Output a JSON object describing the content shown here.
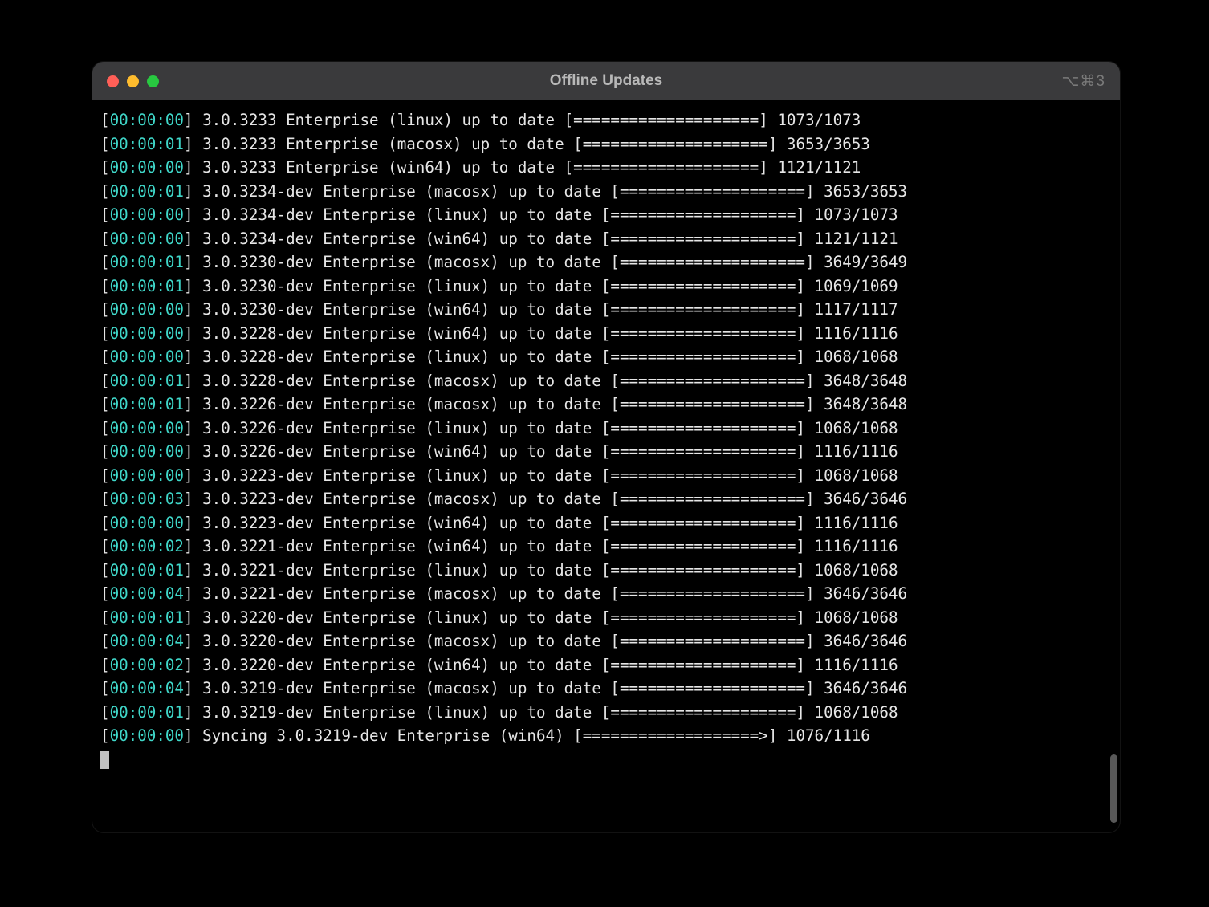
{
  "window": {
    "title": "Offline Updates",
    "shortcut": "⌥⌘3"
  },
  "progress_bars": {
    "full_20": "[====================]",
    "partial_19": "[===================>]"
  },
  "log_lines": [
    {
      "timestamp": "00:00:00",
      "version": "3.0.3233",
      "edition": "Enterprise",
      "platform": "linux",
      "status": "up to date",
      "bar_key": "full_20",
      "done": 1073,
      "total": 1073
    },
    {
      "timestamp": "00:00:01",
      "version": "3.0.3233",
      "edition": "Enterprise",
      "platform": "macosx",
      "status": "up to date",
      "bar_key": "full_20",
      "done": 3653,
      "total": 3653
    },
    {
      "timestamp": "00:00:00",
      "version": "3.0.3233",
      "edition": "Enterprise",
      "platform": "win64",
      "status": "up to date",
      "bar_key": "full_20",
      "done": 1121,
      "total": 1121
    },
    {
      "timestamp": "00:00:01",
      "version": "3.0.3234-dev",
      "edition": "Enterprise",
      "platform": "macosx",
      "status": "up to date",
      "bar_key": "full_20",
      "done": 3653,
      "total": 3653
    },
    {
      "timestamp": "00:00:00",
      "version": "3.0.3234-dev",
      "edition": "Enterprise",
      "platform": "linux",
      "status": "up to date",
      "bar_key": "full_20",
      "done": 1073,
      "total": 1073
    },
    {
      "timestamp": "00:00:00",
      "version": "3.0.3234-dev",
      "edition": "Enterprise",
      "platform": "win64",
      "status": "up to date",
      "bar_key": "full_20",
      "done": 1121,
      "total": 1121
    },
    {
      "timestamp": "00:00:01",
      "version": "3.0.3230-dev",
      "edition": "Enterprise",
      "platform": "macosx",
      "status": "up to date",
      "bar_key": "full_20",
      "done": 3649,
      "total": 3649
    },
    {
      "timestamp": "00:00:01",
      "version": "3.0.3230-dev",
      "edition": "Enterprise",
      "platform": "linux",
      "status": "up to date",
      "bar_key": "full_20",
      "done": 1069,
      "total": 1069
    },
    {
      "timestamp": "00:00:00",
      "version": "3.0.3230-dev",
      "edition": "Enterprise",
      "platform": "win64",
      "status": "up to date",
      "bar_key": "full_20",
      "done": 1117,
      "total": 1117
    },
    {
      "timestamp": "00:00:00",
      "version": "3.0.3228-dev",
      "edition": "Enterprise",
      "platform": "win64",
      "status": "up to date",
      "bar_key": "full_20",
      "done": 1116,
      "total": 1116
    },
    {
      "timestamp": "00:00:00",
      "version": "3.0.3228-dev",
      "edition": "Enterprise",
      "platform": "linux",
      "status": "up to date",
      "bar_key": "full_20",
      "done": 1068,
      "total": 1068
    },
    {
      "timestamp": "00:00:01",
      "version": "3.0.3228-dev",
      "edition": "Enterprise",
      "platform": "macosx",
      "status": "up to date",
      "bar_key": "full_20",
      "done": 3648,
      "total": 3648
    },
    {
      "timestamp": "00:00:01",
      "version": "3.0.3226-dev",
      "edition": "Enterprise",
      "platform": "macosx",
      "status": "up to date",
      "bar_key": "full_20",
      "done": 3648,
      "total": 3648
    },
    {
      "timestamp": "00:00:00",
      "version": "3.0.3226-dev",
      "edition": "Enterprise",
      "platform": "linux",
      "status": "up to date",
      "bar_key": "full_20",
      "done": 1068,
      "total": 1068
    },
    {
      "timestamp": "00:00:00",
      "version": "3.0.3226-dev",
      "edition": "Enterprise",
      "platform": "win64",
      "status": "up to date",
      "bar_key": "full_20",
      "done": 1116,
      "total": 1116
    },
    {
      "timestamp": "00:00:00",
      "version": "3.0.3223-dev",
      "edition": "Enterprise",
      "platform": "linux",
      "status": "up to date",
      "bar_key": "full_20",
      "done": 1068,
      "total": 1068
    },
    {
      "timestamp": "00:00:03",
      "version": "3.0.3223-dev",
      "edition": "Enterprise",
      "platform": "macosx",
      "status": "up to date",
      "bar_key": "full_20",
      "done": 3646,
      "total": 3646
    },
    {
      "timestamp": "00:00:00",
      "version": "3.0.3223-dev",
      "edition": "Enterprise",
      "platform": "win64",
      "status": "up to date",
      "bar_key": "full_20",
      "done": 1116,
      "total": 1116
    },
    {
      "timestamp": "00:00:02",
      "version": "3.0.3221-dev",
      "edition": "Enterprise",
      "platform": "win64",
      "status": "up to date",
      "bar_key": "full_20",
      "done": 1116,
      "total": 1116
    },
    {
      "timestamp": "00:00:01",
      "version": "3.0.3221-dev",
      "edition": "Enterprise",
      "platform": "linux",
      "status": "up to date",
      "bar_key": "full_20",
      "done": 1068,
      "total": 1068
    },
    {
      "timestamp": "00:00:04",
      "version": "3.0.3221-dev",
      "edition": "Enterprise",
      "platform": "macosx",
      "status": "up to date",
      "bar_key": "full_20",
      "done": 3646,
      "total": 3646
    },
    {
      "timestamp": "00:00:01",
      "version": "3.0.3220-dev",
      "edition": "Enterprise",
      "platform": "linux",
      "status": "up to date",
      "bar_key": "full_20",
      "done": 1068,
      "total": 1068
    },
    {
      "timestamp": "00:00:04",
      "version": "3.0.3220-dev",
      "edition": "Enterprise",
      "platform": "macosx",
      "status": "up to date",
      "bar_key": "full_20",
      "done": 3646,
      "total": 3646
    },
    {
      "timestamp": "00:00:02",
      "version": "3.0.3220-dev",
      "edition": "Enterprise",
      "platform": "win64",
      "status": "up to date",
      "bar_key": "full_20",
      "done": 1116,
      "total": 1116
    },
    {
      "timestamp": "00:00:04",
      "version": "3.0.3219-dev",
      "edition": "Enterprise",
      "platform": "macosx",
      "status": "up to date",
      "bar_key": "full_20",
      "done": 3646,
      "total": 3646
    },
    {
      "timestamp": "00:00:01",
      "version": "3.0.3219-dev",
      "edition": "Enterprise",
      "platform": "linux",
      "status": "up to date",
      "bar_key": "full_20",
      "done": 1068,
      "total": 1068
    },
    {
      "timestamp": "00:00:00",
      "version": "3.0.3219-dev",
      "edition": "Enterprise",
      "platform": "win64",
      "status": "Syncing",
      "bar_key": "partial_19",
      "done": 1076,
      "total": 1116
    }
  ]
}
